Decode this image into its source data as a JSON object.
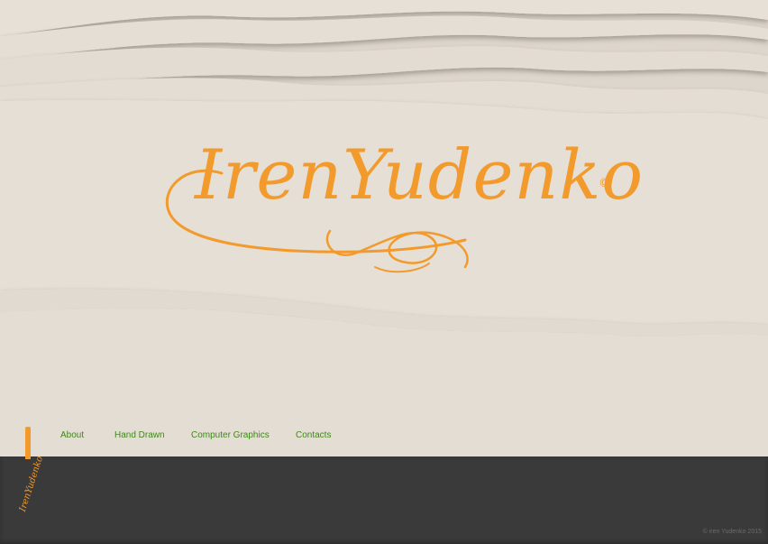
{
  "site": {
    "logo_text": "IrenYudenko",
    "logo_copyright_mark": "©",
    "bookmark_logo_text": "IrenYudenko",
    "footer_copyright": "© iren Yudenko 2015"
  },
  "nav": {
    "items": [
      {
        "label": "About"
      },
      {
        "label": "Hand Drawn"
      },
      {
        "label": "Computer Graphics"
      },
      {
        "label": "Contacts"
      }
    ]
  },
  "colors": {
    "accent_orange": "#f39a2c",
    "nav_green": "#3e8a16",
    "paper": "#e3ddd4",
    "footer_dark": "#3a3a3a"
  }
}
